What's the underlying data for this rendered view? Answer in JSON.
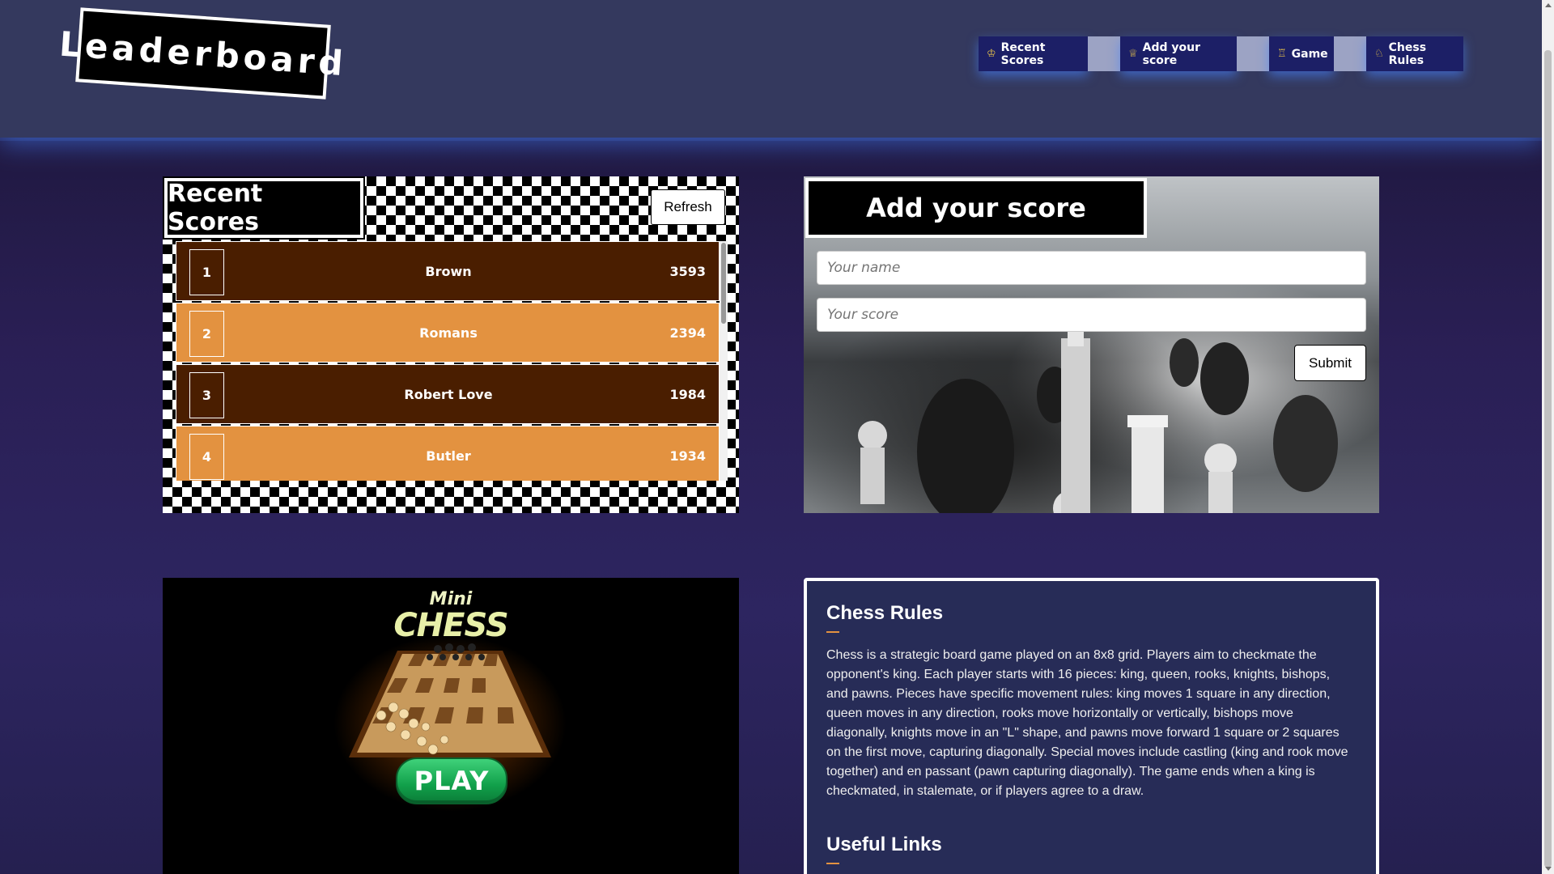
{
  "header": {
    "logo": "Leaderboard",
    "nav": [
      {
        "label": "Recent Scores",
        "icon": "♔"
      },
      {
        "label": "Add your score",
        "icon": "♕"
      },
      {
        "label": "Game",
        "icon": "♖"
      },
      {
        "label": "Chess Rules",
        "icon": "♘"
      }
    ]
  },
  "scores": {
    "title": "Recent Scores",
    "refresh_label": "Refresh",
    "rows": [
      {
        "rank": "1",
        "name": "Brown",
        "score": "3593"
      },
      {
        "rank": "2",
        "name": "Romans",
        "score": "2394"
      },
      {
        "rank": "3",
        "name": "Robert Love",
        "score": "1984"
      },
      {
        "rank": "4",
        "name": "Butler",
        "score": "1934"
      }
    ]
  },
  "add_score": {
    "title": "Add your score",
    "name_placeholder": "Your name",
    "score_placeholder": "Your score",
    "submit_label": "Submit"
  },
  "game": {
    "mini": "Mini",
    "chess": "CHESS",
    "play_label": "PLAY"
  },
  "rules": {
    "title": "Chess Rules",
    "text": "Chess is a strategic board game played on an 8x8 grid. Players aim to checkmate the opponent's king. Each player starts with 16 pieces: king, queen, rooks, knights, bishops, and pawns. Pieces have specific movement rules: king moves 1 square in any direction, queen moves in any direction, rooks move horizontally or vertically, bishops move diagonally, knights move in an \"L\" shape, and pawns move forward 1 square or 2 squares on the first move, capturing diagonally. Special moves include castling (king and rook move together) and en passant (pawn capturing diagonally). The game ends when a king is checkmated, in stalemate, or if players agree to a draw.",
    "links_title": "Useful Links"
  },
  "colors": {
    "header_bg": "#34395e",
    "nav_bg": "#1c1f66",
    "row_dark": "#4a1e00",
    "row_light": "#e39240",
    "accent": "#e39240",
    "play_green": "#11a04a"
  }
}
